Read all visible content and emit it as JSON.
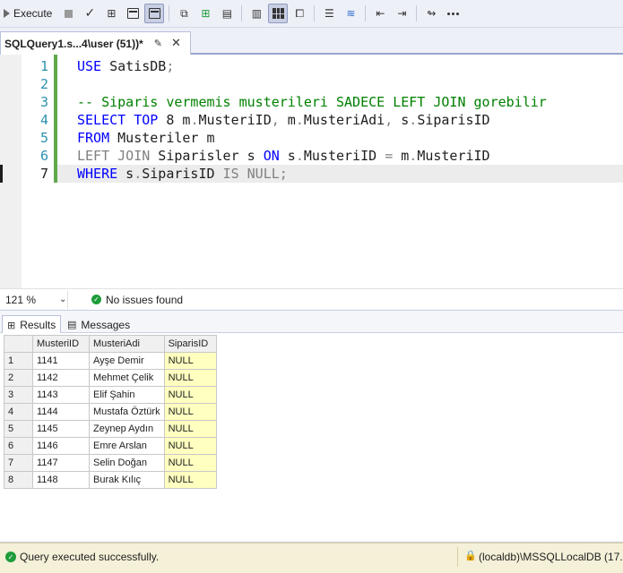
{
  "toolbar": {
    "execute_label": "Execute"
  },
  "tab": {
    "title": "SQLQuery1.s...4\\user (51))*"
  },
  "editor": {
    "line_numbers": [
      "1",
      "2",
      "3",
      "4",
      "5",
      "6",
      "7"
    ],
    "lines": [
      [
        {
          "t": "USE",
          "c": "kw"
        },
        {
          "t": " SatisDB",
          "c": ""
        },
        {
          "t": ";",
          "c": "gr"
        }
      ],
      [],
      [
        {
          "t": "-- Siparis vermemis musterileri SADECE LEFT JOIN gorebilir",
          "c": "cm"
        }
      ],
      [
        {
          "t": "SELECT TOP",
          "c": "kw"
        },
        {
          "t": " 8 m",
          "c": ""
        },
        {
          "t": ".",
          "c": "gr"
        },
        {
          "t": "MusteriID",
          "c": ""
        },
        {
          "t": ",",
          "c": "gr"
        },
        {
          "t": " m",
          "c": ""
        },
        {
          "t": ".",
          "c": "gr"
        },
        {
          "t": "MusteriAdi",
          "c": ""
        },
        {
          "t": ",",
          "c": "gr"
        },
        {
          "t": " s",
          "c": ""
        },
        {
          "t": ".",
          "c": "gr"
        },
        {
          "t": "SiparisID",
          "c": ""
        }
      ],
      [
        {
          "t": "FROM",
          "c": "kw"
        },
        {
          "t": " Musteriler m",
          "c": ""
        }
      ],
      [
        {
          "t": "LEFT JOIN",
          "c": "gr"
        },
        {
          "t": " Siparisler s ",
          "c": ""
        },
        {
          "t": "ON",
          "c": "kw"
        },
        {
          "t": " s",
          "c": ""
        },
        {
          "t": ".",
          "c": "gr"
        },
        {
          "t": "MusteriID ",
          "c": ""
        },
        {
          "t": "=",
          "c": "gr"
        },
        {
          "t": " m",
          "c": ""
        },
        {
          "t": ".",
          "c": "gr"
        },
        {
          "t": "MusteriID",
          "c": ""
        }
      ],
      [
        {
          "t": "WHERE",
          "c": "kw"
        },
        {
          "t": " s",
          "c": ""
        },
        {
          "t": ".",
          "c": "gr"
        },
        {
          "t": "SiparisID ",
          "c": ""
        },
        {
          "t": "IS NULL",
          "c": "gr"
        },
        {
          "t": ";",
          "c": "gr"
        }
      ]
    ],
    "current_line": 7
  },
  "status": {
    "zoom": "121 %",
    "issues": "No issues found"
  },
  "results_tabs": {
    "results": "Results",
    "messages": "Messages"
  },
  "grid": {
    "columns": [
      "MusteriID",
      "MusteriAdi",
      "SiparisID"
    ],
    "rows": [
      {
        "n": "1",
        "id": "1141",
        "name": "Ayşe Demir",
        "sid": "NULL"
      },
      {
        "n": "2",
        "id": "1142",
        "name": "Mehmet Çelik",
        "sid": "NULL"
      },
      {
        "n": "3",
        "id": "1143",
        "name": "Elif Şahin",
        "sid": "NULL"
      },
      {
        "n": "4",
        "id": "1144",
        "name": "Mustafa Öztürk",
        "sid": "NULL"
      },
      {
        "n": "5",
        "id": "1145",
        "name": "Zeynep Aydın",
        "sid": "NULL"
      },
      {
        "n": "6",
        "id": "1146",
        "name": "Emre Arslan",
        "sid": "NULL"
      },
      {
        "n": "7",
        "id": "1147",
        "name": "Selin Doğan",
        "sid": "NULL"
      },
      {
        "n": "8",
        "id": "1148",
        "name": "Burak Kılıç",
        "sid": "NULL"
      }
    ]
  },
  "statusbar": {
    "message": "Query executed successfully.",
    "server": "(localdb)\\MSSQLLocalDB (17..."
  },
  "colors": {
    "keyword": "#0000ff",
    "comment": "#008000",
    "operator": "#808080",
    "null_cell": "#ffffc0",
    "statusbar": "#f5f0d8"
  }
}
